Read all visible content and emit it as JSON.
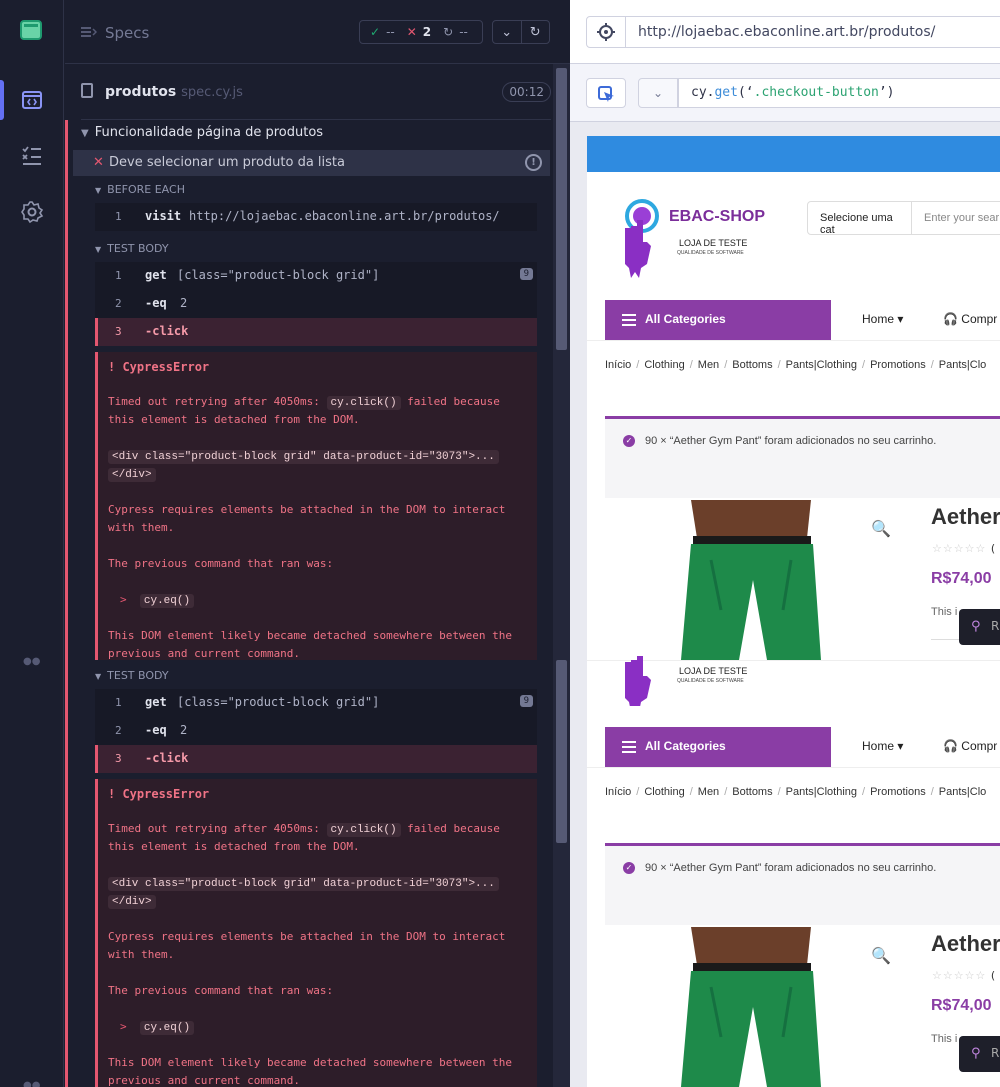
{
  "sidebar": {
    "items": [
      {
        "icon": "runs-icon",
        "active": true
      },
      {
        "icon": "specs-list-icon",
        "active": false
      },
      {
        "icon": "gear-icon",
        "active": false
      }
    ]
  },
  "reporter": {
    "specs_label": "Specs",
    "stats": {
      "passed": "--",
      "failed": "2",
      "pending": "--"
    },
    "file": {
      "name": "produtos",
      "ext": "spec.cy.js",
      "duration": "00:12"
    },
    "suite_title": "Funcionalidade página de produtos",
    "test_title": "Deve selecionar um produto da lista",
    "before_each_label": "BEFORE EACH",
    "before_each_cmds": [
      {
        "n": "1",
        "name": "visit",
        "arg": "http://lojaebac.ebaconline.art.br/produtos/"
      }
    ],
    "test_body_label": "TEST BODY",
    "attempts": [
      {
        "commands": [
          {
            "n": "1",
            "name": "get",
            "arg": "[class=\"product-block grid\"]",
            "badge": "9"
          },
          {
            "n": "2",
            "name": "-eq",
            "arg": "2"
          },
          {
            "n": "3",
            "name": "-click",
            "arg": ""
          }
        ],
        "error": {
          "title": "! CypressError",
          "line1a": "Timed out retrying after 4050ms: ",
          "line1code": "cy.click()",
          "line1b": " failed because",
          "line2": "this element is detached from the DOM.",
          "html1": "<div class=\"product-block grid\" data-product-id=\"3073\">...",
          "html2": "</div>",
          "req1": "Cypress requires elements be attached in the DOM to interact",
          "req2": "with them.",
          "prev": "The previous command that ran was:",
          "prevcmd": "cy.eq()",
          "likely1": "This DOM element likely became detached somewhere between the",
          "likely2": "previous and current command."
        }
      },
      {
        "commands": [
          {
            "n": "1",
            "name": "get",
            "arg": "[class=\"product-block grid\"]",
            "badge": "9"
          },
          {
            "n": "2",
            "name": "-eq",
            "arg": "2"
          },
          {
            "n": "3",
            "name": "-click",
            "arg": ""
          }
        ],
        "error": {
          "title": "! CypressError",
          "line1a": "Timed out retrying after 4050ms: ",
          "line1code": "cy.click()",
          "line1b": " failed because",
          "line2": "this element is detached from the DOM.",
          "html1": "<div class=\"product-block grid\" data-product-id=\"3073\">...",
          "html2": "</div>",
          "req1": "Cypress requires elements be attached in the DOM to interact",
          "req2": "with them.",
          "prev": "The previous command that ran was:",
          "prevcmd": "cy.eq()",
          "likely1": "This DOM element likely became detached somewhere between the",
          "likely2": "previous and current command."
        }
      }
    ]
  },
  "aut": {
    "url": "http://lojaebac.ebaconline.art.br/produtos/",
    "selector": {
      "prefix": "cy.",
      "fn": "get",
      "open": "(‘",
      "str": ".checkout-button",
      "close": "’)"
    },
    "shop": {
      "logo_title": "EBAC-SHOP",
      "logo_sub": "LOJA DE TESTE",
      "logo_sub2": "QUALIDADE DE SOFTWARE",
      "category_select": "Selecione uma cat",
      "search_placeholder": "Enter your sear",
      "all_categories": "All Categories",
      "menu_home": "Home",
      "menu_compr": "Compr",
      "breadcrumbs": [
        "Início",
        "Clothing",
        "Men",
        "Bottoms",
        "Pants|Clothing",
        "Promotions",
        "Pants|Clo"
      ],
      "notice": "90 × “Aether Gym Pant” foram adicionados no seu carrinho.",
      "product_name": "Aether",
      "rating_suffix": "(",
      "price": "R$74,00",
      "desc": "This i",
      "pin_label": "R"
    },
    "colors": {
      "brand": "#8a3da5",
      "blue": "#2f8be0",
      "error": "#e45770"
    }
  }
}
